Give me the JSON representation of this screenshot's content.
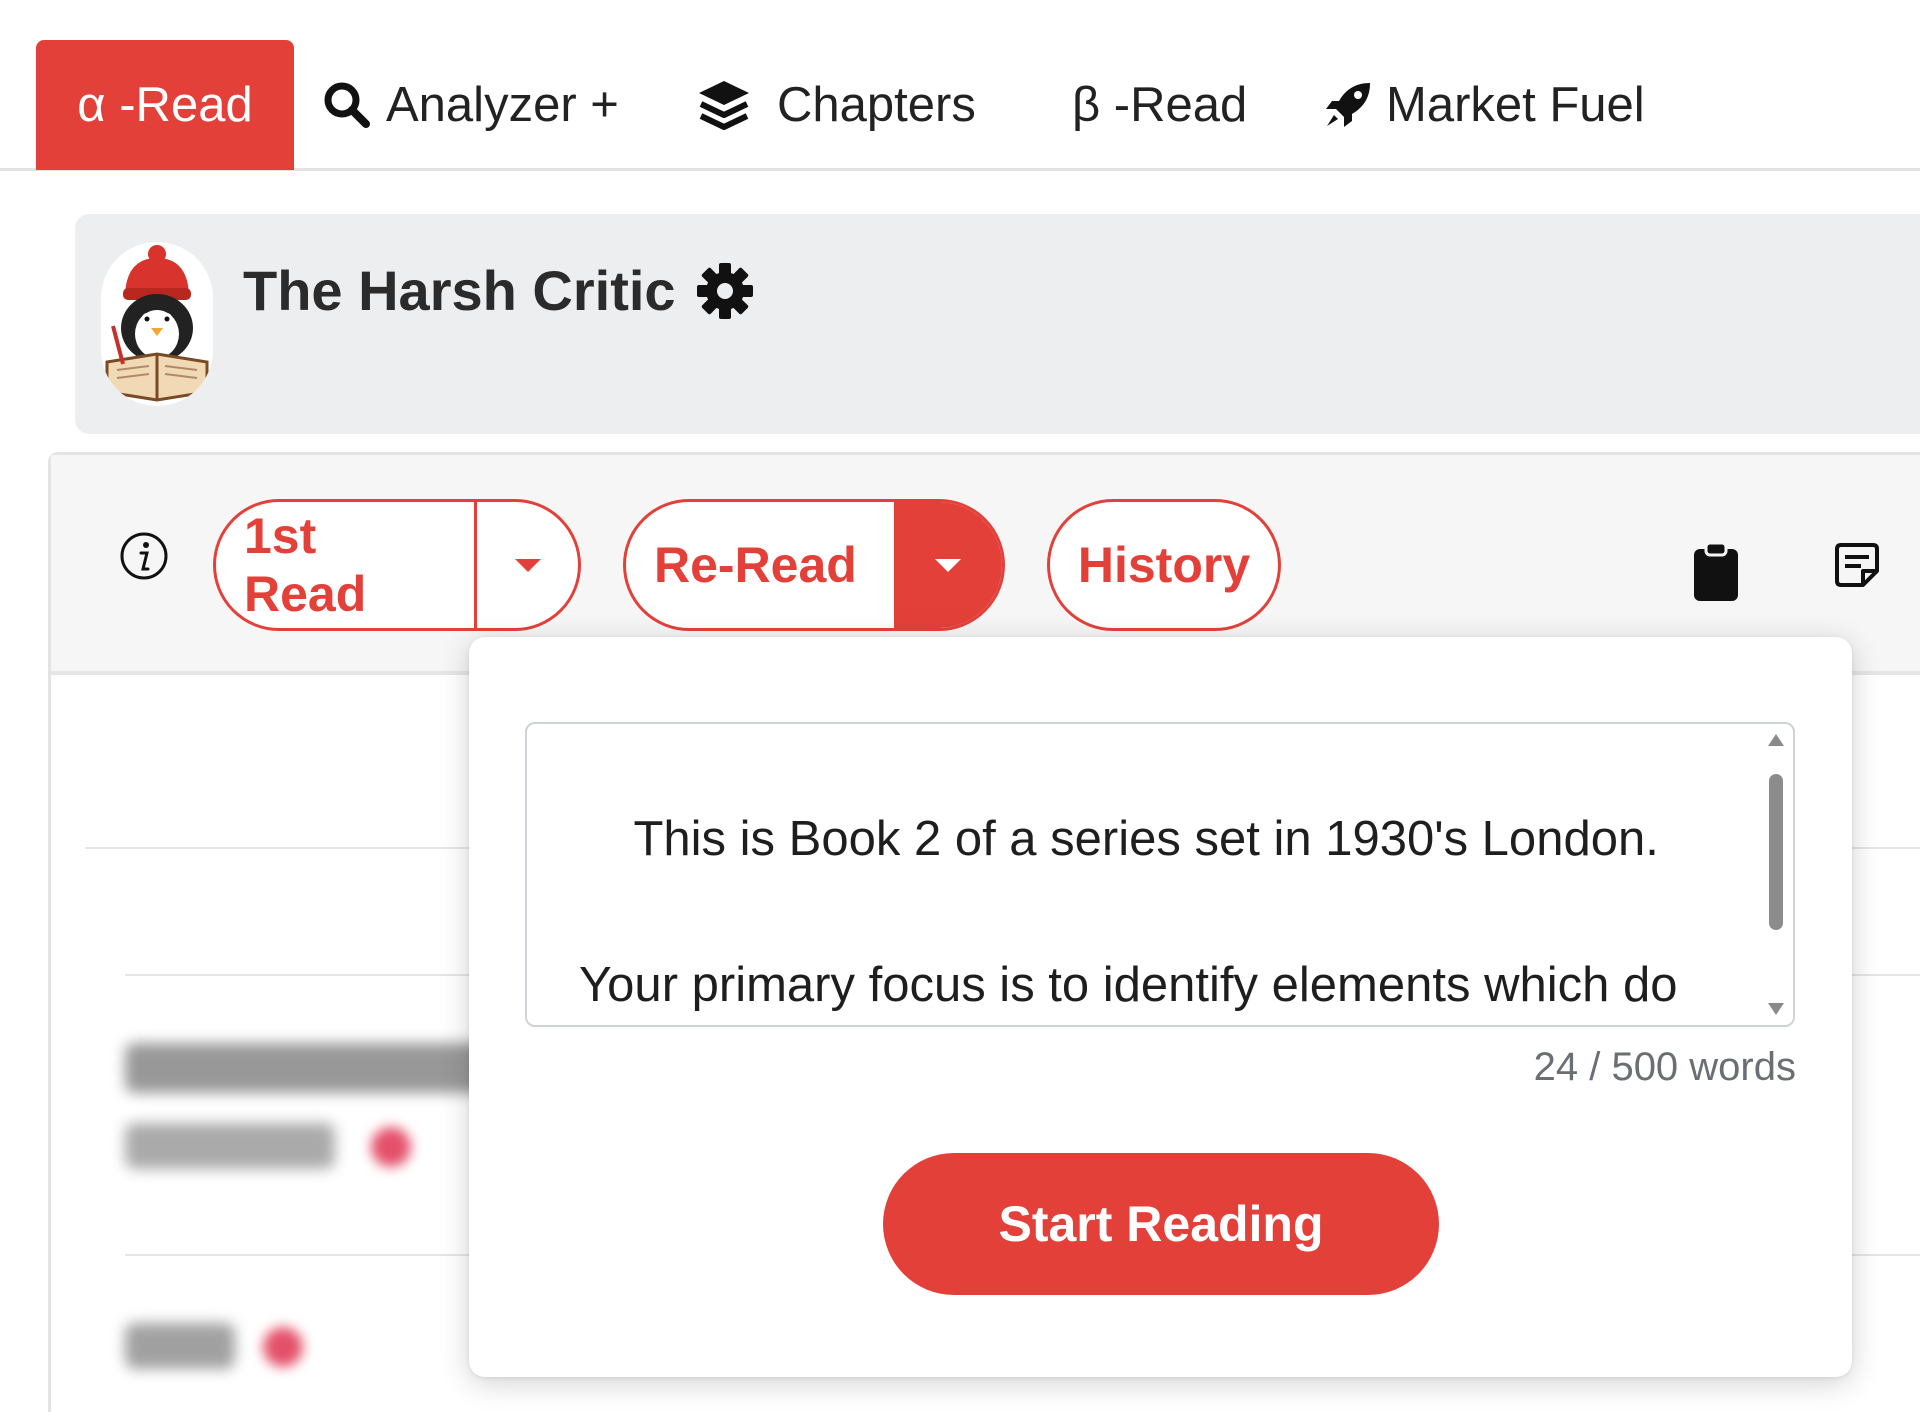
{
  "nav": {
    "tabs": [
      {
        "label": "α -Read",
        "icon": "alpha",
        "active": true
      },
      {
        "label": "Analyzer +",
        "icon": "search-icon",
        "active": false
      },
      {
        "label": "Chapters",
        "icon": "layers-icon",
        "active": false
      },
      {
        "label": "β -Read",
        "icon": "",
        "active": false
      },
      {
        "label": "Market Fuel",
        "icon": "rocket-icon",
        "active": false
      }
    ]
  },
  "persona": {
    "name": "The Harsh Critic",
    "avatar_icon": "penguin-reader-avatar",
    "settings_icon": "gear-icon"
  },
  "toolbar": {
    "info_icon": "info-icon",
    "first_read_label": "1st Read",
    "reread_label": "Re-Read",
    "history_label": "History",
    "clipboard_icon": "clipboard-icon",
    "notes_icon": "note-icon"
  },
  "popover": {
    "prompt_text": "This is Book 2 of a series set in 1930's London.\n\nYour primary focus is to identify elements which do not belong in the story.",
    "word_count": "24 / 500 words",
    "start_label": "Start Reading"
  },
  "colors": {
    "accent": "#e4403a",
    "header_bg": "#eceef0",
    "toolbar_bg": "#f6f6f7"
  }
}
